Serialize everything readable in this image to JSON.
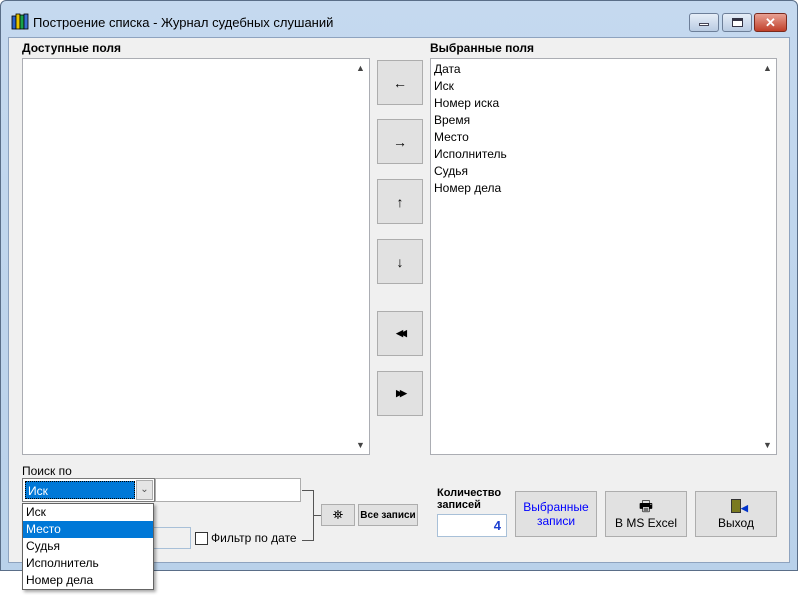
{
  "window": {
    "title": "Построение списка - Журнал судебных слушаний"
  },
  "available": {
    "label": "Доступные поля",
    "items": []
  },
  "selected": {
    "label": "Выбранные поля",
    "items": [
      "Дата",
      "Иск",
      "Номер иска",
      "Время",
      "Место",
      "Исполнитель",
      "Судья",
      "Номер дела"
    ]
  },
  "arrows": {
    "left": "←",
    "right": "→",
    "up": "↑",
    "down": "↓",
    "all_left": "◀◀",
    "all_right": "▶▶"
  },
  "search": {
    "label": "Поиск по",
    "selected": "Иск",
    "value": "",
    "options": [
      "Иск",
      "Место",
      "Судья",
      "Исполнитель",
      "Номер дела"
    ],
    "highlighted": "Место"
  },
  "filter": {
    "label": "Фильтр по дате",
    "checked": false
  },
  "buttons": {
    "all_records": "Все записи",
    "selected_records": "Выбранные записи",
    "excel": "В MS Excel",
    "exit": "Выход"
  },
  "count": {
    "label": "Количество записей",
    "value": "4"
  },
  "colors": {
    "selection": "#0078d7",
    "link_text": "#0000ff"
  }
}
